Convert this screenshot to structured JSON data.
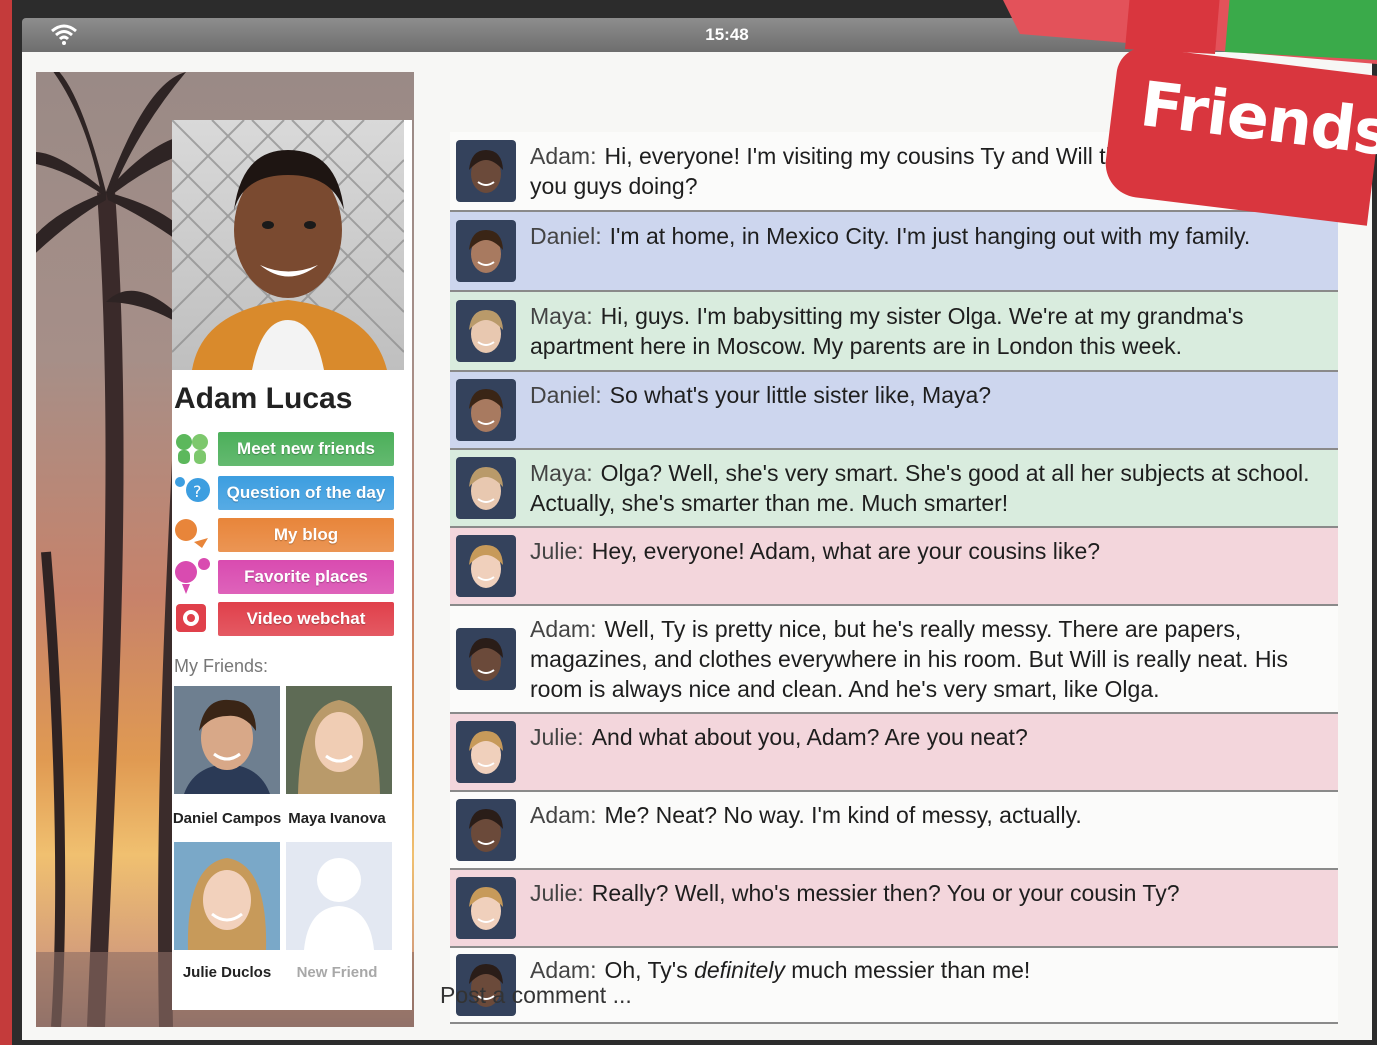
{
  "status_bar": {
    "time": "15:48"
  },
  "logo": {
    "text": "Friends"
  },
  "profile": {
    "name": "Adam Lucas",
    "menu": [
      {
        "label": "Meet new friends",
        "color": "#4caf5a",
        "icon": "people-icon"
      },
      {
        "label": "Question of the day",
        "color": "#3d9ee0",
        "icon": "question-icon"
      },
      {
        "label": "My blog",
        "color": "#e8853a",
        "icon": "blog-icon"
      },
      {
        "label": "Favorite places",
        "color": "#d94bb0",
        "icon": "pin-icon"
      },
      {
        "label": "Video webchat",
        "color": "#e0404b",
        "icon": "video-icon"
      }
    ],
    "friends_label": "My Friends:",
    "friends": [
      {
        "name": "Daniel Campos"
      },
      {
        "name": "Maya Ivanova"
      },
      {
        "name": "Julie Duclos"
      },
      {
        "name": "New Friend"
      }
    ]
  },
  "chat": {
    "messages": [
      {
        "author": "Adam:",
        "text": "Hi, everyone! I'm visiting my cousins Ty and Will this week. What are you guys doing?",
        "color": "white"
      },
      {
        "author": "Daniel:",
        "text": "I'm at home, in Mexico City. I'm just hanging out with my family.",
        "color": "blue"
      },
      {
        "author": "Maya:",
        "text": "Hi, guys. I'm babysitting my sister Olga. We're at my grandma's apartment here in Moscow. My parents are in London this week.",
        "color": "green"
      },
      {
        "author": "Daniel:",
        "text": "So what's your little sister like, Maya?",
        "color": "blue"
      },
      {
        "author": "Maya:",
        "text": "Olga? Well, she's very smart. She's good at all her subjects at school. Actually, she's smarter than me. Much smarter!",
        "color": "green"
      },
      {
        "author": "Julie:",
        "text": "Hey, everyone! Adam, what are your cousins like?",
        "color": "pink"
      },
      {
        "author": "Adam:",
        "text": "Well, Ty is pretty nice, but he's really messy. There are papers, magazines, and clothes everywhere in his room. But Will is really neat. His room is always nice and clean. And he's very smart, like Olga.",
        "color": "white"
      },
      {
        "author": "Julie:",
        "text": "And what about you, Adam? Are you neat?",
        "color": "pink"
      },
      {
        "author": "Adam:",
        "text": "Me? Neat? No way. I'm kind of messy, actually.",
        "color": "white"
      },
      {
        "author": "Julie:",
        "text": "Really? Well, who's messier then? You or your cousin Ty?",
        "color": "pink"
      },
      {
        "author": "Adam:",
        "text_before": "Oh, Ty's ",
        "text_emph": "definitely",
        "text_after": " much messier than me!",
        "color": "white"
      }
    ],
    "post_placeholder": "Post a comment ..."
  }
}
